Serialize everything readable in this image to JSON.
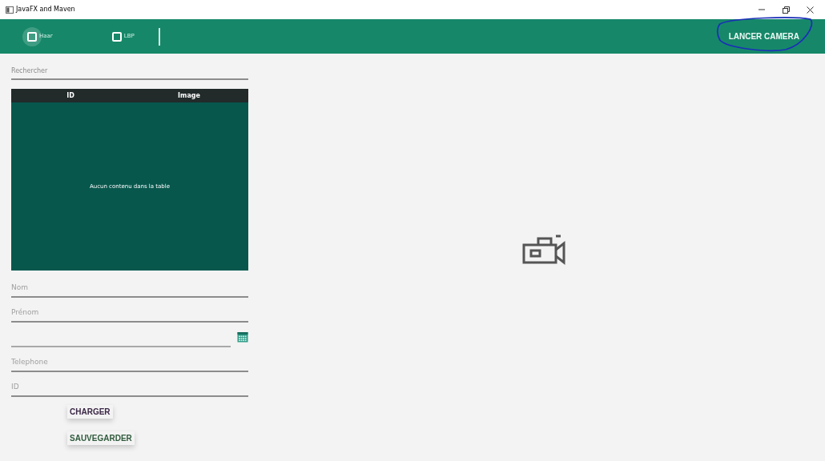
{
  "window": {
    "title": "JavaFX and Maven"
  },
  "toolbar": {
    "checkboxes": [
      {
        "label": "Haar",
        "checked": false,
        "focused": true
      },
      {
        "label": "LBP",
        "checked": false,
        "focused": false
      }
    ],
    "camera_button": "LANCER CAMERA"
  },
  "search": {
    "placeholder": "Rechercher"
  },
  "table": {
    "columns": [
      "ID",
      "Image"
    ],
    "placeholder": "Aucun contenu dans la table"
  },
  "form": {
    "fields": [
      {
        "kind": "text",
        "placeholder": "Nom"
      },
      {
        "kind": "text",
        "placeholder": "Prénom"
      },
      {
        "kind": "date"
      },
      {
        "kind": "text",
        "placeholder": "Telephone"
      },
      {
        "kind": "text",
        "placeholder": "ID"
      }
    ],
    "buttons": [
      {
        "label": "CHARGER",
        "color": "#3b2747"
      },
      {
        "label": "SAUVEGARDER",
        "color": "#2f5a3c"
      }
    ]
  }
}
